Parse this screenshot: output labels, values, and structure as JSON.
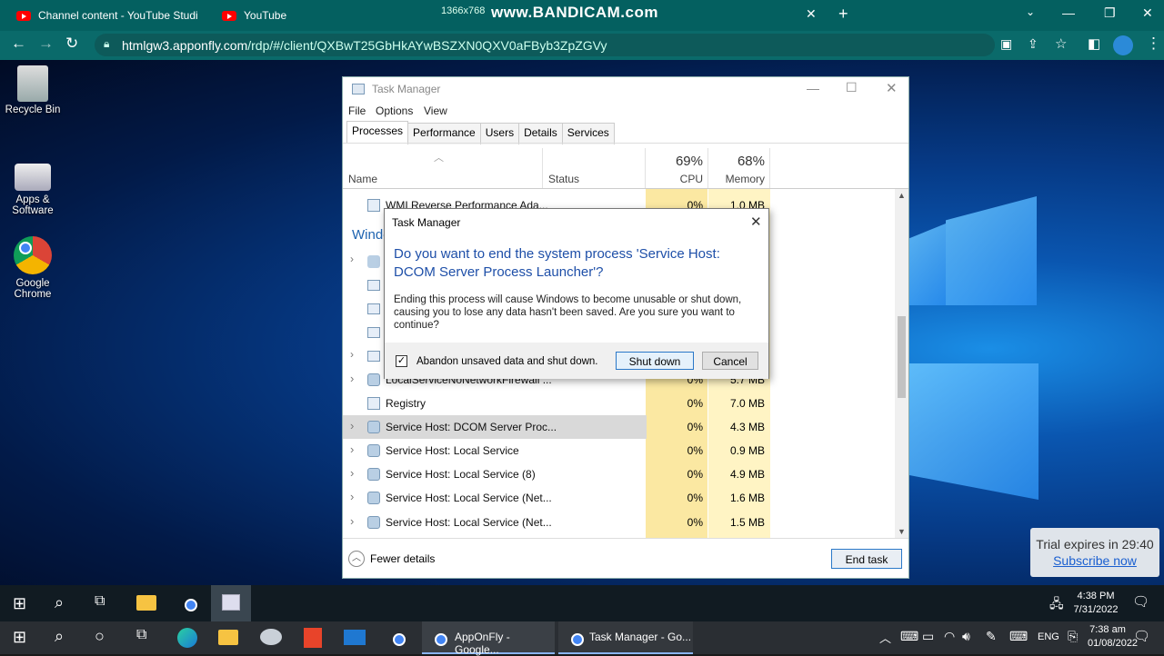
{
  "browser": {
    "tabs": [
      {
        "label": "Channel content - YouTube Studi"
      },
      {
        "label": "YouTube"
      }
    ],
    "recording_resolution": "1366x768",
    "watermark": "www.BANDICAM.com",
    "url_host": "htmlgw3.apponfly.com",
    "url_path": "/rdp/#/client/QXBwT25GbHkAYwBSZXN0QXV0aFByb3ZpZGVy"
  },
  "desktop": {
    "icons": [
      {
        "label": "Recycle Bin"
      },
      {
        "label": "Apps & Software"
      },
      {
        "label": "Google Chrome"
      }
    ]
  },
  "task_manager": {
    "title": "Task Manager",
    "menu": [
      "File",
      "Options",
      "View"
    ],
    "tabs": [
      "Processes",
      "Performance",
      "Users",
      "Details",
      "Services"
    ],
    "columns": {
      "name": "Name",
      "status": "Status",
      "cpu_pct": "69%",
      "cpu": "CPU",
      "mem_pct": "68%",
      "mem": "Memory"
    },
    "group_heading": "Windo",
    "top_row": {
      "name": "WMI Reverse Performance Ada...",
      "cpu": "0%",
      "mem": "1.0 MB"
    },
    "partial_row": {
      "name": "LocalServiceNoNetworkFirewall ...",
      "cpu": "0%",
      "mem": "5.7 MB"
    },
    "rows": [
      {
        "name": "Registry",
        "cpu": "0%",
        "mem": "7.0 MB"
      },
      {
        "name": "Service Host: DCOM Server Proc...",
        "cpu": "0%",
        "mem": "4.3 MB"
      },
      {
        "name": "Service Host: Local Service",
        "cpu": "0%",
        "mem": "0.9 MB"
      },
      {
        "name": "Service Host: Local Service (8)",
        "cpu": "0%",
        "mem": "4.9 MB"
      },
      {
        "name": "Service Host: Local Service (Net...",
        "cpu": "0%",
        "mem": "1.6 MB"
      },
      {
        "name": "Service Host: Local Service (Net...",
        "cpu": "0%",
        "mem": "1.5 MB"
      }
    ],
    "fewer_details": "Fewer details",
    "end_task": "End task"
  },
  "dialog": {
    "title": "Task Manager",
    "question": "Do you want to end the system process 'Service Host: DCOM Server Process Launcher'?",
    "body": "Ending this process will cause Windows to become unusable or shut down, causing you to lose any data hasn't been saved. Are you sure you want to continue?",
    "checkbox_label": "Abandon unsaved data and shut down.",
    "checkbox_checked": true,
    "shutdown": "Shut down",
    "cancel": "Cancel"
  },
  "trial": {
    "text": "Trial expires in 29:40",
    "link": "Subscribe now"
  },
  "remote_taskbar": {
    "time": "4:38 PM",
    "date": "7/31/2022"
  },
  "local_taskbar": {
    "apps": [
      {
        "label": "AppOnFly - Google..."
      },
      {
        "label": "Task Manager - Go..."
      }
    ],
    "lang": "ENG",
    "time": "7:38 am",
    "date": "01/08/2022"
  }
}
